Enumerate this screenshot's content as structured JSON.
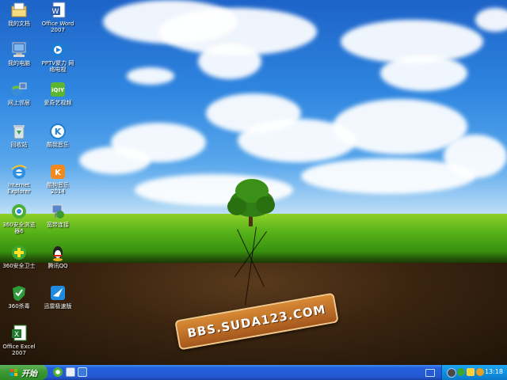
{
  "desktop": {
    "icons": [
      {
        "label": "我的文档",
        "icon": "folder-documents-icon"
      },
      {
        "label": "Office Word\n2007",
        "icon": "word-icon"
      },
      {
        "label": "我的电脑",
        "icon": "computer-icon"
      },
      {
        "label": "PPTV聚力 网\n络电视",
        "icon": "pptv-icon"
      },
      {
        "label": "网上邻居",
        "icon": "network-icon"
      },
      {
        "label": "爱奇艺视频",
        "icon": "iqiyi-icon"
      },
      {
        "label": "回收站",
        "icon": "recycle-bin-icon"
      },
      {
        "label": "酷我音乐",
        "icon": "kuwo-icon"
      },
      {
        "label": "Internet\nExplorer",
        "icon": "internet-explorer-icon"
      },
      {
        "label": "酷狗音乐\n2014",
        "icon": "kugou-icon"
      },
      {
        "label": "360安全浏览\n器6",
        "icon": "360-browser-icon"
      },
      {
        "label": "宽带连接",
        "icon": "broadband-icon"
      },
      {
        "label": "360安全卫士",
        "icon": "360-guard-icon"
      },
      {
        "label": "腾讯QQ",
        "icon": "qq-icon"
      },
      {
        "label": "360杀毒",
        "icon": "360-antivirus-icon"
      },
      {
        "label": "迅雷极速版",
        "icon": "xunlei-icon"
      },
      {
        "label": "Office Excel\n2007",
        "icon": "excel-icon"
      }
    ],
    "watermark": "BBS.SUDA123.COM"
  },
  "taskbar": {
    "start_label": "开始",
    "clock": "13:18"
  },
  "colors": {
    "taskbar_blue": "#245edb",
    "start_green": "#3a9a33",
    "tray_blue": "#1290e0"
  }
}
